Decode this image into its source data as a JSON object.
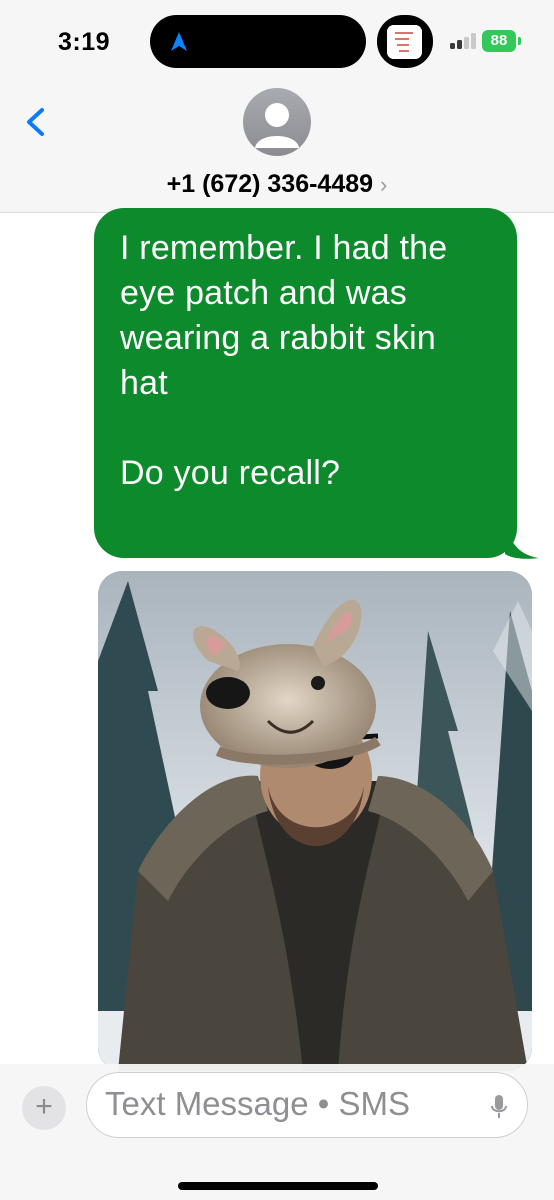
{
  "status_bar": {
    "time": "3:19",
    "battery_level": "88"
  },
  "header": {
    "contact_name": "+1 (672) 336-4489",
    "chevron": "›"
  },
  "messages": [
    {
      "direction": "outgoing",
      "text": "I remember. I had the\neye patch and was\nwearing a rabbit skin\nhat\n\nDo you recall?"
    },
    {
      "direction": "outgoing",
      "type": "image",
      "image_name": "photo-attachment"
    }
  ],
  "composer": {
    "plus_label": "+",
    "placeholder": "Text Message • SMS"
  },
  "colors": {
    "sms_bubble": "#0d8a2c",
    "ios_blue": "#0a7aff",
    "battery": "#34c759"
  },
  "icons": {
    "back": "chevron-left-icon",
    "nav": "location-arrow-icon",
    "mic": "microphone-icon",
    "avatar": "person-icon"
  }
}
